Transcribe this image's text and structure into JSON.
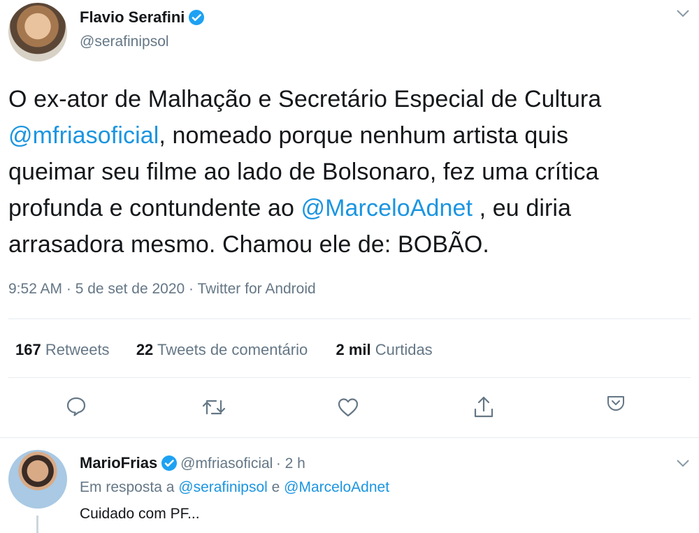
{
  "tweet": {
    "author_name": "Flavio Serafini",
    "author_handle": "@serafinipsol",
    "body": {
      "t1": "O ex-ator de Malhação e Secretário Especial de Cultura",
      "m1": "@mfriasoficial",
      "t2": ", nomeado porque nenhum artista quis",
      "t3": "queimar seu filme ao lado de Bolsonaro, fez uma crítica",
      "t4": "profunda e contundente ao ",
      "m2": "@MarceloAdnet",
      "t5": " , eu diria",
      "t6": "arrasadora mesmo. Chamou ele de: BOBÃO."
    },
    "meta": "9:52 AM · 5 de set de 2020 · Twitter for Android",
    "stats": {
      "retweets_count": "167",
      "retweets_label": "Retweets",
      "comments_count": "22",
      "comments_label": "Tweets de comentário",
      "likes_count": "2 mil",
      "likes_label": "Curtidas"
    },
    "actions": [
      "reply-icon",
      "retweet-icon",
      "like-icon",
      "share-icon",
      "more-icon"
    ]
  },
  "reply": {
    "author_name": "MarioFrias",
    "author_handle": "@mfriasoficial",
    "time": "· 2 h",
    "in_reply_prefix": "Em resposta a",
    "in_reply_user1": "@serafinipsol",
    "in_reply_joiner": "e",
    "in_reply_user2": "@MarceloAdnet",
    "text": "Cuidado com PF..."
  },
  "colors": {
    "link": "#1b95e0",
    "muted": "#657786",
    "verified": "#1da1f2"
  }
}
